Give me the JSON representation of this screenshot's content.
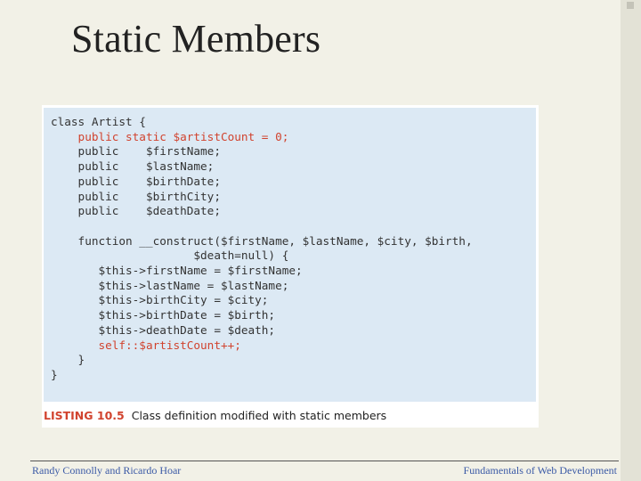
{
  "slide": {
    "title": "Static Members"
  },
  "listing": {
    "code_lines": [
      {
        "text": "class Artist {",
        "highlight": false
      },
      {
        "text": "    public static $artistCount = 0;",
        "highlight": true
      },
      {
        "text": "    public    $firstName;",
        "highlight": false
      },
      {
        "text": "    public    $lastName;",
        "highlight": false
      },
      {
        "text": "    public    $birthDate;",
        "highlight": false
      },
      {
        "text": "    public    $birthCity;",
        "highlight": false
      },
      {
        "text": "    public    $deathDate;",
        "highlight": false
      },
      {
        "text": "",
        "highlight": false
      },
      {
        "text": "    function __construct($firstName, $lastName, $city, $birth,",
        "highlight": false
      },
      {
        "text": "                     $death=null) {",
        "highlight": false
      },
      {
        "text": "       $this->firstName = $firstName;",
        "highlight": false
      },
      {
        "text": "       $this->lastName = $lastName;",
        "highlight": false
      },
      {
        "text": "       $this->birthCity = $city;",
        "highlight": false
      },
      {
        "text": "       $this->birthDate = $birth;",
        "highlight": false
      },
      {
        "text": "       $this->deathDate = $death;",
        "highlight": false
      },
      {
        "text": "       self::$artistCount++;",
        "highlight": true
      },
      {
        "text": "    }",
        "highlight": false
      },
      {
        "text": "}",
        "highlight": false
      }
    ],
    "caption_label": "LISTING 10.5",
    "caption_text": "Class definition modified with static members",
    "highlight_color": "#d1432e",
    "code_background": "#dce9f4"
  },
  "footer": {
    "left": "Randy Connolly and Ricardo Hoar",
    "right": "Fundamentals of Web Development"
  }
}
